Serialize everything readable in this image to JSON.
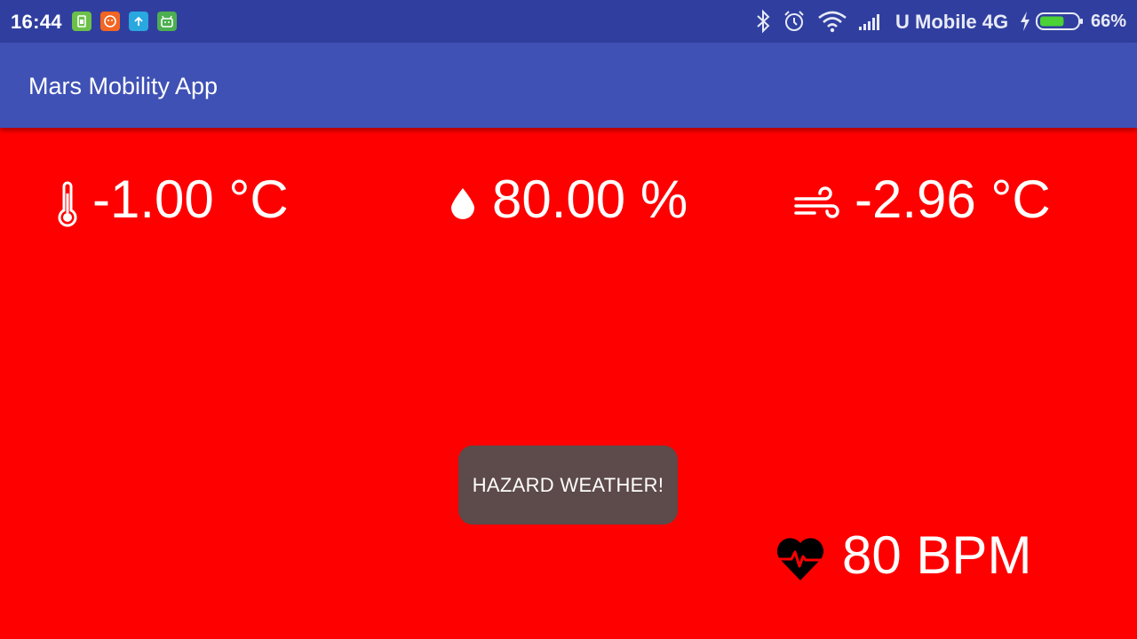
{
  "status_bar": {
    "time": "16:44",
    "notification_icons": [
      "sim-app-icon",
      "fox-app-icon",
      "upload-icon",
      "android-app-icon"
    ],
    "carrier": "U Mobile 4G",
    "battery_percent": "66%",
    "battery_level": 0.66
  },
  "app_bar": {
    "title": "Mars Mobility App"
  },
  "readings": {
    "temperature": "-1.00 °C",
    "humidity": "80.00 %",
    "wind_chill": "-2.96 °C",
    "heart_rate": "80 BPM"
  },
  "toast": {
    "message": "HAZARD WEATHER!"
  },
  "colors": {
    "background": "#ff0000",
    "status_bar": "#303f9f",
    "app_bar": "#3f51b5",
    "toast": "#5d4a4a"
  }
}
